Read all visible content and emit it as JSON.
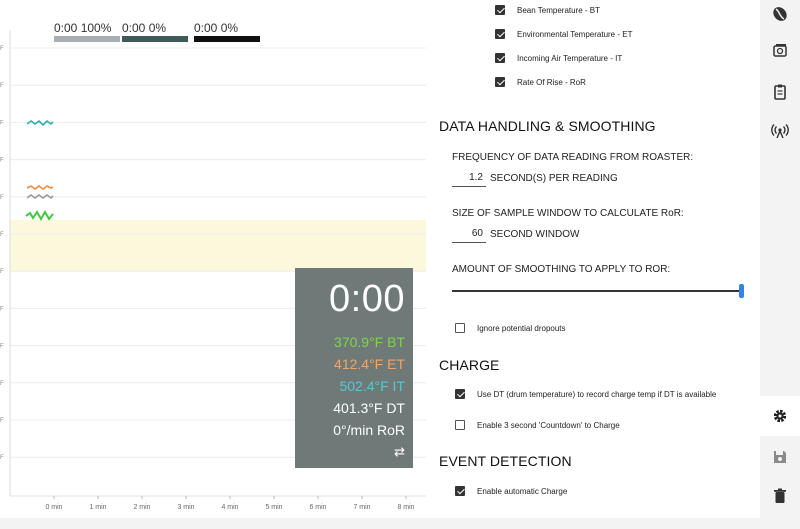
{
  "legend": [
    {
      "text": "0:00 100%",
      "color": "#a9aeb2"
    },
    {
      "text": "0:00 0%",
      "color": "#3f5a5a"
    },
    {
      "text": "0:00 0%",
      "color": "#111111"
    }
  ],
  "chart_data": {
    "type": "line",
    "xlabel": "",
    "ylabel": "",
    "x_ticks": [
      "0 min",
      "1 min",
      "2 min",
      "3 min",
      "4 min",
      "5 min",
      "6 min",
      "7 min",
      "8 min"
    ],
    "y_tick_labels": [
      "F",
      "F",
      "F",
      "F",
      "F",
      "F",
      "F",
      "F",
      "F",
      "F",
      "F",
      "F"
    ],
    "series_colors": {
      "it": "#2ab0b3",
      "et": "#f08a3a",
      "dt": "#9a9a9a",
      "bt": "#3fcb3f"
    }
  },
  "overlay": {
    "time": "0:00",
    "bt": "370.9°F BT",
    "et": "412.4°F ET",
    "it": "502.4°F IT",
    "dt": "401.3°F DT",
    "ror": "0°/min RoR",
    "bt_color": "#7ad64a",
    "et_color": "#f5a460",
    "it_color": "#55c7d6",
    "swap_icon": "swap-icon"
  },
  "panel": {
    "curves": [
      {
        "label": "Bean Temperature - BT",
        "checked": true
      },
      {
        "label": "Environmental Temperature - ET",
        "checked": true
      },
      {
        "label": "Incoming Air Temperature - IT",
        "checked": true
      },
      {
        "label": "Rate Of Rise - RoR",
        "checked": true
      }
    ],
    "data_handling": {
      "title": "DATA HANDLING & SMOOTHING",
      "freq_label": "FREQUENCY OF DATA READING FROM ROASTER:",
      "freq_value": "1.2",
      "freq_unit": "SECOND(S) PER READING",
      "window_label": "SIZE OF SAMPLE WINDOW TO CALCULATE RoR:",
      "window_value": "60",
      "window_unit": "SECOND WINDOW",
      "smoothing_label": "AMOUNT OF SMOOTHING TO APPLY TO ROR:",
      "smoothing_value": 1.0,
      "dropouts_label": "Ignore potential dropouts",
      "dropouts_checked": false
    },
    "charge": {
      "title": "CHARGE",
      "use_dt_label": "Use DT (drum temperature) to record charge temp if DT is available",
      "use_dt_checked": true,
      "countdown_label": "Enable 3 second 'Countdown' to Charge",
      "countdown_checked": false
    },
    "event_detection": {
      "title": "EVENT DETECTION",
      "auto_charge_label": "Enable automatic Charge",
      "auto_charge_checked": true
    }
  },
  "rail": {
    "icons": [
      "bean-icon",
      "roaster-icon",
      "clipboard-icon",
      "broadcast-icon",
      "gear-icon",
      "save-icon",
      "trash-icon"
    ]
  }
}
